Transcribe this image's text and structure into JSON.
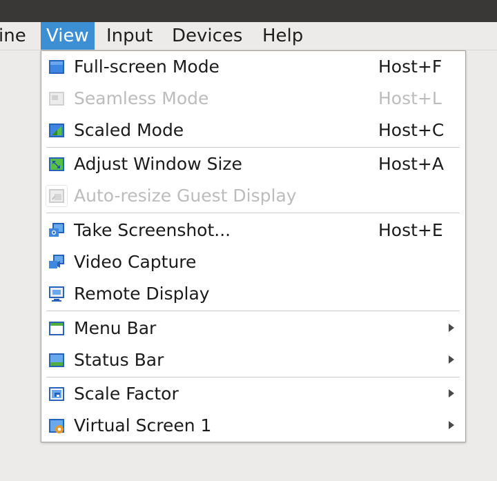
{
  "menubar": {
    "items": [
      {
        "label": "ine"
      },
      {
        "label": "View"
      },
      {
        "label": "Input"
      },
      {
        "label": "Devices"
      },
      {
        "label": "Help"
      }
    ]
  },
  "view_menu": {
    "items": [
      {
        "label": "Full-screen Mode",
        "shortcut": "Host+F",
        "icon": "fullscreen-icon"
      },
      {
        "label": "Seamless Mode",
        "shortcut": "Host+L",
        "icon": "seamless-icon",
        "disabled": true
      },
      {
        "label": "Scaled Mode",
        "shortcut": "Host+C",
        "icon": "scaled-mode-icon"
      },
      {
        "label": "Adjust Window Size",
        "shortcut": "Host+A",
        "icon": "adjust-window-icon"
      },
      {
        "label": "Auto-resize Guest Display",
        "shortcut": "",
        "icon": "auto-resize-icon",
        "disabled": true
      },
      {
        "label": "Take Screenshot...",
        "shortcut": "Host+E",
        "icon": "screenshot-icon"
      },
      {
        "label": "Video Capture",
        "shortcut": "",
        "icon": "video-capture-icon"
      },
      {
        "label": "Remote Display",
        "shortcut": "",
        "icon": "remote-display-icon"
      },
      {
        "label": "Menu Bar",
        "shortcut": "",
        "icon": "menu-bar-icon",
        "submenu": true
      },
      {
        "label": "Status Bar",
        "shortcut": "",
        "icon": "status-bar-icon",
        "submenu": true
      },
      {
        "label": "Scale Factor",
        "shortcut": "",
        "icon": "scale-factor-icon",
        "submenu": true
      },
      {
        "label": "Virtual Screen 1",
        "shortcut": "",
        "icon": "virtual-screen-icon",
        "submenu": true
      }
    ]
  },
  "colors": {
    "menubar_active": "#3c8fd3",
    "disabled_text": "#bcbcbc",
    "titlebar": "#3a3836"
  }
}
